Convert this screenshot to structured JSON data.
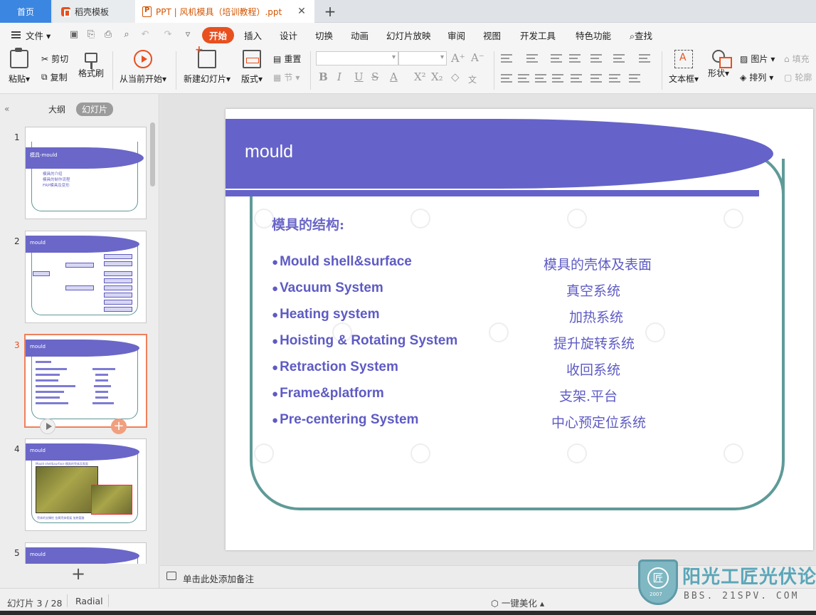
{
  "tabs": {
    "home": "首页",
    "template": "稻壳模板",
    "document": "PPT | 风机模具（培训教程）.ppt",
    "close": "✕",
    "add": "+"
  },
  "menu": {
    "file": "文件",
    "items": [
      "开始",
      "插入",
      "设计",
      "切换",
      "动画",
      "幻灯片放映",
      "审阅",
      "视图",
      "开发工具",
      "特色功能"
    ],
    "search": "查找"
  },
  "ribbon": {
    "paste": "粘贴",
    "cut": "剪切",
    "copy": "复制",
    "format_painter": "格式刷",
    "from_current": "从当前开始",
    "new_slide": "新建幻灯片",
    "layout": "版式",
    "reset": "重置",
    "section": "节",
    "textbox": "文本框",
    "shape": "形状",
    "picture": "图片",
    "arrange": "排列",
    "fill": "填充",
    "outline": "轮廓"
  },
  "left_panel": {
    "outline_tab": "大纲",
    "slides_tab": "幻灯片",
    "collapse": "«",
    "add": "+",
    "thumbnails": [
      {
        "num": "1",
        "title": "模具-mould",
        "lines": [
          "模具的介绍",
          "模具的制作流程",
          "FRP模具及变形"
        ]
      },
      {
        "num": "2",
        "title": "mould"
      },
      {
        "num": "3",
        "title": "mould"
      },
      {
        "num": "4",
        "title": "mould",
        "caption": "Mould shell&surface 模具的壳体及表面",
        "footer": "壳体的支撑柱 金属壳体框架 加热管路"
      },
      {
        "num": "5",
        "title": "mould"
      }
    ]
  },
  "slide": {
    "title": "mould",
    "heading": "模具的结构:",
    "rows": [
      {
        "en": "Mould shell&surface",
        "cn": "模具的壳体及表面"
      },
      {
        "en": "Vacuum System",
        "cn": "真空系统"
      },
      {
        "en": "Heating system",
        "cn": "加热系统"
      },
      {
        "en": "Hoisting & Rotating System",
        "cn": "提升旋转系统"
      },
      {
        "en": "Retraction System",
        "cn": "收回系统"
      },
      {
        "en": "Frame&platform",
        "cn": "支架.平台"
      },
      {
        "en": "Pre-centering System",
        "cn": "中心预定位系统"
      }
    ]
  },
  "notes": {
    "placeholder": "单击此处添加备注"
  },
  "status": {
    "slide_counter": "幻灯片 3 / 28",
    "theme": "Radial",
    "beautify": "一键美化"
  },
  "watermark": {
    "site": "阳光工匠光伏论坛",
    "url": "BBS. 21SPV. COM",
    "year": "2007",
    "emblem": "匠"
  },
  "colors": {
    "accent": "#e8501f",
    "slide_band": "#6563c9",
    "slide_text": "#5e5bc4",
    "slide_frame": "#5f9a98"
  }
}
